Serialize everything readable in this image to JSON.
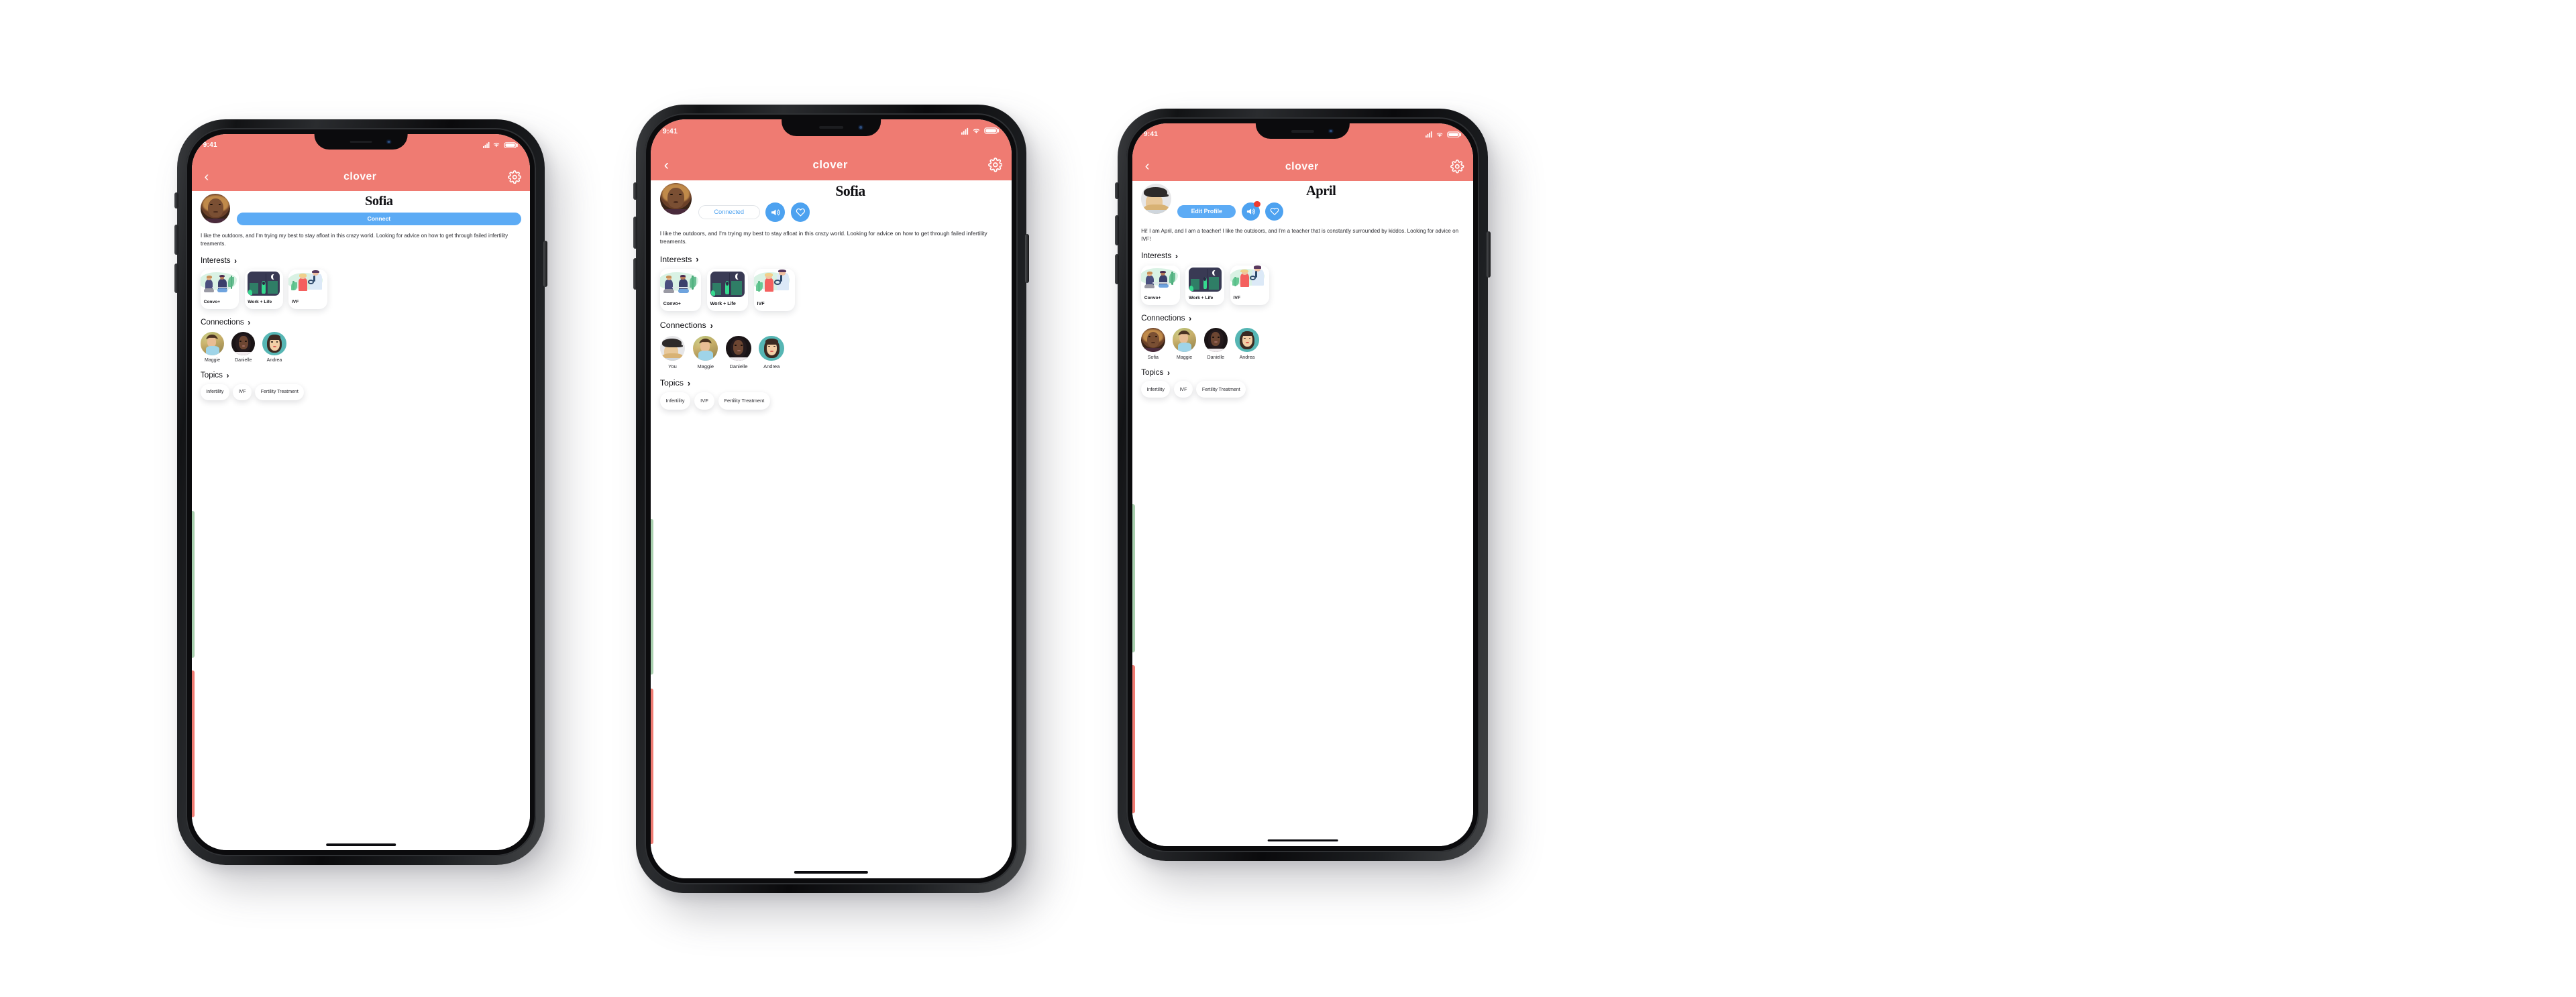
{
  "brand": {
    "name": "clover",
    "header_color": "#ef7b72",
    "accent_blue": "#4da2f0",
    "badge_red": "#ef3b30"
  },
  "status_bar": {
    "time": "9:41",
    "signal_icon": "cellular-signal-icon",
    "wifi_icon": "wifi-icon",
    "battery_icon": "battery-icon"
  },
  "nav": {
    "back_icon": "chevron-left-icon",
    "title": "clover",
    "settings_icon": "gear-icon"
  },
  "sections": {
    "interests_label": "Interests",
    "connections_label": "Connections",
    "topics_label": "Topics",
    "chevron": "›"
  },
  "interests": [
    {
      "label": "Convo+",
      "art": "two-people-talking-illustration"
    },
    {
      "label": "Work + Life",
      "art": "woman-city-night-illustration"
    },
    {
      "label": "IVF",
      "art": "doctor-patient-illustration"
    }
  ],
  "topics": [
    {
      "label": "Infertility"
    },
    {
      "label": "IVF"
    },
    {
      "label": "Fertility Treatment"
    }
  ],
  "screens": [
    {
      "id": "sofia-not-connected",
      "profile": {
        "name": "Sofia",
        "avatar": "sofia-avatar",
        "bio": "I like the outdoors, and I'm trying my best to stay afloat in this crazy world. Looking for advice on how to get through failed infertility treaments."
      },
      "primary_action": {
        "label": "Connect",
        "style": "filled"
      },
      "secondary_actions": [],
      "connections": [
        {
          "name": "Maggie",
          "avatar": "maggie-avatar"
        },
        {
          "name": "Danielle",
          "avatar": "danielle-avatar"
        },
        {
          "name": "Andrea",
          "avatar": "andrea-avatar"
        }
      ]
    },
    {
      "id": "sofia-connected",
      "profile": {
        "name": "Sofia",
        "avatar": "sofia-avatar",
        "bio": "I like the outdoors, and I'm trying my best to stay afloat in this crazy world. Looking for advice on how to get through failed infertility treaments."
      },
      "primary_action": {
        "label": "Connected",
        "style": "outline"
      },
      "secondary_actions": [
        {
          "icon": "megaphone-icon",
          "badge": false
        },
        {
          "icon": "heart-icon",
          "badge": false
        }
      ],
      "connections": [
        {
          "name": "You",
          "avatar": "april-avatar"
        },
        {
          "name": "Maggie",
          "avatar": "maggie-avatar"
        },
        {
          "name": "Danielle",
          "avatar": "danielle-avatar"
        },
        {
          "name": "Andrea",
          "avatar": "andrea-avatar"
        }
      ]
    },
    {
      "id": "april-own-profile",
      "profile": {
        "name": "April",
        "avatar": "april-avatar",
        "bio": "Hi! I am April, and I am a teacher! I like the outdoors, and I'm a teacher that is constantly surrounded by kiddos. Looking for advice on IVF!"
      },
      "primary_action": {
        "label": "Edit Profile",
        "style": "filled"
      },
      "secondary_actions": [
        {
          "icon": "megaphone-icon",
          "badge": true
        },
        {
          "icon": "heart-icon",
          "badge": false
        }
      ],
      "connections": [
        {
          "name": "Sofia",
          "avatar": "sofia-avatar"
        },
        {
          "name": "Maggie",
          "avatar": "maggie-avatar"
        },
        {
          "name": "Danielle",
          "avatar": "danielle-avatar"
        },
        {
          "name": "Andrea",
          "avatar": "andrea-avatar"
        }
      ]
    }
  ]
}
